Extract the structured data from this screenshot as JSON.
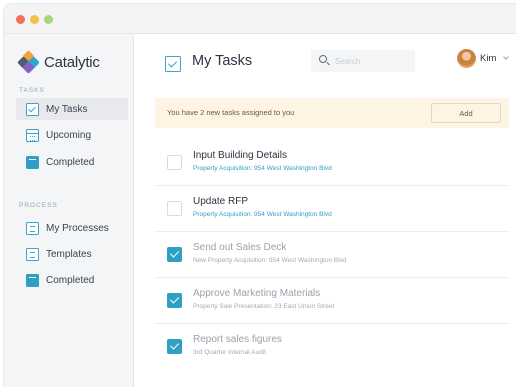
{
  "app": {
    "brand": "Catalytic"
  },
  "sidebar": {
    "tasks_label": "TASKS",
    "tasks_items": [
      {
        "label": "My Tasks",
        "icon": "task-check-icon",
        "active": true
      },
      {
        "label": "Upcoming",
        "icon": "calendar-icon",
        "active": false
      },
      {
        "label": "Completed",
        "icon": "archive-box-icon",
        "active": false
      }
    ],
    "process_label": "PROCESS",
    "process_items": [
      {
        "label": "My Processes",
        "icon": "list-icon"
      },
      {
        "label": "Templates",
        "icon": "template-icon"
      },
      {
        "label": "Completed",
        "icon": "archive-box-icon"
      }
    ]
  },
  "header": {
    "title": "My Tasks",
    "search_placeholder": "Search",
    "user_name": "Kim"
  },
  "banner": {
    "text": "You have 2 new tasks assigned to you",
    "add_label": "Add"
  },
  "tasks": [
    {
      "title": "Input Building Details",
      "subtitle": "Property Acquisition: 954 West Washington Blvd",
      "done": false
    },
    {
      "title": "Update RFP",
      "subtitle": "Property Acquisition: 954 West Washington Blvd",
      "done": false
    },
    {
      "title": "Send out Sales Deck",
      "subtitle": "New Property Acquisition: 954 West Washington Blvd",
      "done": true
    },
    {
      "title": "Approve Marketing Materials",
      "subtitle": "Property Sale Presentation: 23 East Union Street",
      "done": true
    },
    {
      "title": "Report sales figures",
      "subtitle": "3rd Quarter Internal Audit",
      "done": true
    }
  ],
  "colors": {
    "accent": "#2fa0c4",
    "banner_bg": "#fdf4e3",
    "sidebar_bg": "#f4f5f6",
    "traffic_red": "#f26f5e",
    "traffic_yellow": "#f5c043",
    "traffic_green": "#a8d57d"
  }
}
